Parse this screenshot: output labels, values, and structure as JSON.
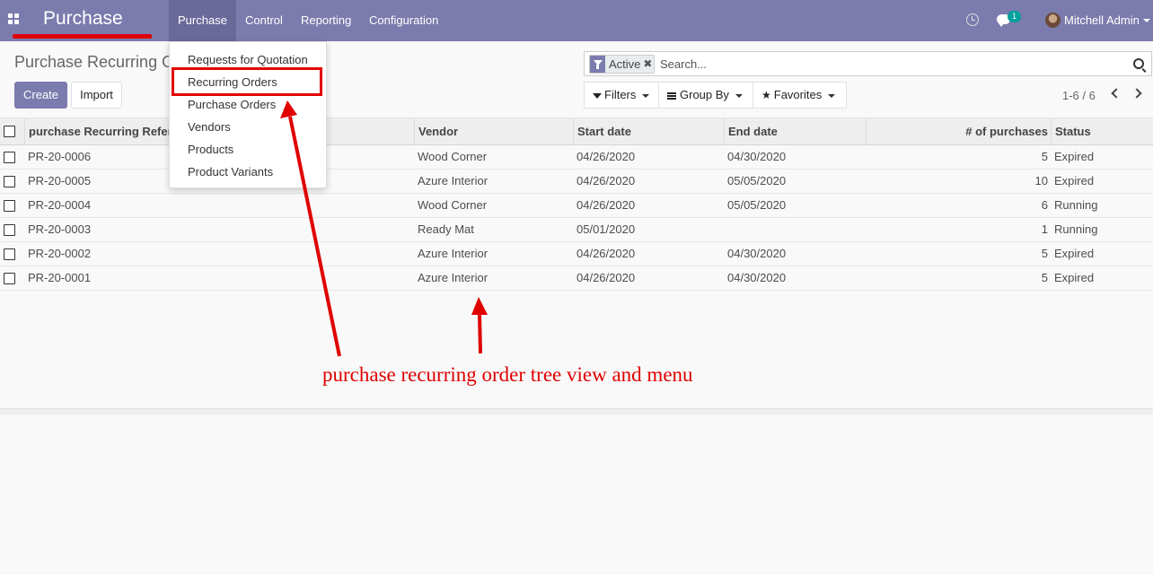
{
  "navbar": {
    "app_title": "Purchase",
    "menu": [
      {
        "label": "Purchase",
        "active": true
      },
      {
        "label": "Control"
      },
      {
        "label": "Reporting"
      },
      {
        "label": "Configuration"
      }
    ],
    "chat_badge": "1",
    "user_name": "Mitchell Admin"
  },
  "page": {
    "title": "Purchase Recurring O",
    "create_label": "Create",
    "import_label": "Import"
  },
  "search": {
    "facet_label": "Active",
    "facet_remove": "✖",
    "placeholder": "Search..."
  },
  "filters": {
    "filters_label": "Filters",
    "group_by_label": "Group By",
    "favorites_label": "Favorites"
  },
  "pager": {
    "value": "1-6 / 6"
  },
  "dropdown": {
    "items": [
      "Requests for Quotation",
      "Recurring Orders",
      "Purchase Orders",
      "Vendors",
      "Products",
      "Product Variants"
    ]
  },
  "table": {
    "headers": [
      "purchase Recurring Reference",
      "Vendor",
      "Start date",
      "End date",
      "# of purchases",
      "Status"
    ],
    "rows": [
      {
        "ref": "PR-20-0006",
        "vendor": "Wood Corner",
        "start": "04/26/2020",
        "end": "04/30/2020",
        "count": "5",
        "status": "Expired"
      },
      {
        "ref": "PR-20-0005",
        "vendor": "Azure Interior",
        "start": "04/26/2020",
        "end": "05/05/2020",
        "count": "10",
        "status": "Expired"
      },
      {
        "ref": "PR-20-0004",
        "vendor": "Wood Corner",
        "start": "04/26/2020",
        "end": "05/05/2020",
        "count": "6",
        "status": "Running"
      },
      {
        "ref": "PR-20-0003",
        "vendor": "Ready Mat",
        "start": "05/01/2020",
        "end": "",
        "count": "1",
        "status": "Running"
      },
      {
        "ref": "PR-20-0002",
        "vendor": "Azure Interior",
        "start": "04/26/2020",
        "end": "04/30/2020",
        "count": "5",
        "status": "Expired"
      },
      {
        "ref": "PR-20-0001",
        "vendor": "Azure Interior",
        "start": "04/26/2020",
        "end": "04/30/2020",
        "count": "5",
        "status": "Expired"
      }
    ]
  },
  "annotation": {
    "text": "purchase recurring order tree view and menu",
    "color": "#e00000"
  },
  "colors": {
    "brand": "#7c7bad",
    "badge": "#00a09d"
  }
}
